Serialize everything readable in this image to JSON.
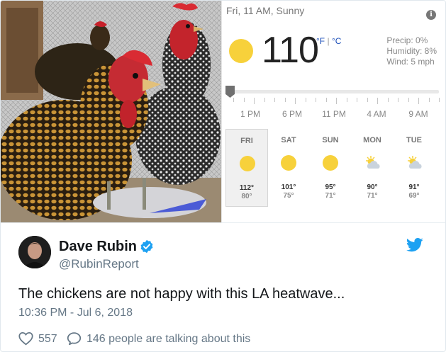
{
  "weather": {
    "date_condition": "Fri, 11 AM, Sunny",
    "temperature": "110",
    "unit_f": "°F",
    "unit_sep": "|",
    "unit_c": "°C",
    "precip": "Precip: 0%",
    "humidity": "Humidity: 8%",
    "wind": "Wind: 5 mph",
    "hours": [
      "1 PM",
      "6 PM",
      "11 PM",
      "4 AM",
      "9 AM"
    ],
    "days": [
      {
        "name": "FRI",
        "icon": "sun-icon",
        "hi": "112°",
        "lo": "80°",
        "selected": true
      },
      {
        "name": "SAT",
        "icon": "sun-icon",
        "hi": "101°",
        "lo": "75°",
        "selected": false
      },
      {
        "name": "SUN",
        "icon": "sun-icon",
        "hi": "95°",
        "lo": "71°",
        "selected": false
      },
      {
        "name": "MON",
        "icon": "partly-cloudy-icon",
        "hi": "90°",
        "lo": "71°",
        "selected": false
      },
      {
        "name": "TUE",
        "icon": "partly-cloudy-icon",
        "hi": "91°",
        "lo": "69°",
        "selected": false
      }
    ]
  },
  "tweet": {
    "author_name": "Dave Rubin",
    "author_handle": "@RubinReport",
    "text": "The chickens are not happy with this LA heatwave...",
    "timestamp": "10:36 PM - Jul 6, 2018",
    "likes": "557",
    "replies": "146 people are talking about this"
  },
  "colors": {
    "twitter_blue": "#1da1f2",
    "sun_yellow": "#f7d13b",
    "muted_text": "#657786"
  }
}
